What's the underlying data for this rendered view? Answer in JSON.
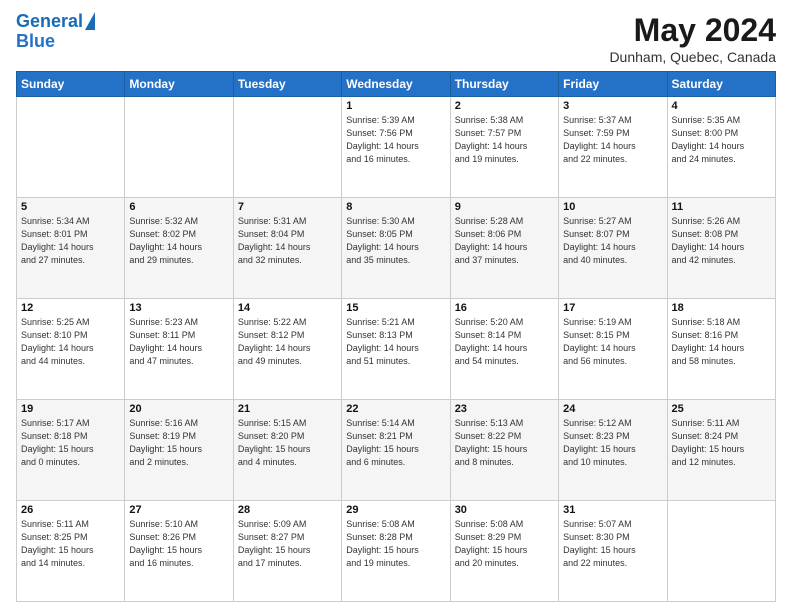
{
  "header": {
    "logo_line1": "General",
    "logo_line2": "Blue",
    "title": "May 2024",
    "location": "Dunham, Quebec, Canada"
  },
  "weekdays": [
    "Sunday",
    "Monday",
    "Tuesday",
    "Wednesday",
    "Thursday",
    "Friday",
    "Saturday"
  ],
  "weeks": [
    [
      {
        "day": "",
        "info": ""
      },
      {
        "day": "",
        "info": ""
      },
      {
        "day": "",
        "info": ""
      },
      {
        "day": "1",
        "info": "Sunrise: 5:39 AM\nSunset: 7:56 PM\nDaylight: 14 hours\nand 16 minutes."
      },
      {
        "day": "2",
        "info": "Sunrise: 5:38 AM\nSunset: 7:57 PM\nDaylight: 14 hours\nand 19 minutes."
      },
      {
        "day": "3",
        "info": "Sunrise: 5:37 AM\nSunset: 7:59 PM\nDaylight: 14 hours\nand 22 minutes."
      },
      {
        "day": "4",
        "info": "Sunrise: 5:35 AM\nSunset: 8:00 PM\nDaylight: 14 hours\nand 24 minutes."
      }
    ],
    [
      {
        "day": "5",
        "info": "Sunrise: 5:34 AM\nSunset: 8:01 PM\nDaylight: 14 hours\nand 27 minutes."
      },
      {
        "day": "6",
        "info": "Sunrise: 5:32 AM\nSunset: 8:02 PM\nDaylight: 14 hours\nand 29 minutes."
      },
      {
        "day": "7",
        "info": "Sunrise: 5:31 AM\nSunset: 8:04 PM\nDaylight: 14 hours\nand 32 minutes."
      },
      {
        "day": "8",
        "info": "Sunrise: 5:30 AM\nSunset: 8:05 PM\nDaylight: 14 hours\nand 35 minutes."
      },
      {
        "day": "9",
        "info": "Sunrise: 5:28 AM\nSunset: 8:06 PM\nDaylight: 14 hours\nand 37 minutes."
      },
      {
        "day": "10",
        "info": "Sunrise: 5:27 AM\nSunset: 8:07 PM\nDaylight: 14 hours\nand 40 minutes."
      },
      {
        "day": "11",
        "info": "Sunrise: 5:26 AM\nSunset: 8:08 PM\nDaylight: 14 hours\nand 42 minutes."
      }
    ],
    [
      {
        "day": "12",
        "info": "Sunrise: 5:25 AM\nSunset: 8:10 PM\nDaylight: 14 hours\nand 44 minutes."
      },
      {
        "day": "13",
        "info": "Sunrise: 5:23 AM\nSunset: 8:11 PM\nDaylight: 14 hours\nand 47 minutes."
      },
      {
        "day": "14",
        "info": "Sunrise: 5:22 AM\nSunset: 8:12 PM\nDaylight: 14 hours\nand 49 minutes."
      },
      {
        "day": "15",
        "info": "Sunrise: 5:21 AM\nSunset: 8:13 PM\nDaylight: 14 hours\nand 51 minutes."
      },
      {
        "day": "16",
        "info": "Sunrise: 5:20 AM\nSunset: 8:14 PM\nDaylight: 14 hours\nand 54 minutes."
      },
      {
        "day": "17",
        "info": "Sunrise: 5:19 AM\nSunset: 8:15 PM\nDaylight: 14 hours\nand 56 minutes."
      },
      {
        "day": "18",
        "info": "Sunrise: 5:18 AM\nSunset: 8:16 PM\nDaylight: 14 hours\nand 58 minutes."
      }
    ],
    [
      {
        "day": "19",
        "info": "Sunrise: 5:17 AM\nSunset: 8:18 PM\nDaylight: 15 hours\nand 0 minutes."
      },
      {
        "day": "20",
        "info": "Sunrise: 5:16 AM\nSunset: 8:19 PM\nDaylight: 15 hours\nand 2 minutes."
      },
      {
        "day": "21",
        "info": "Sunrise: 5:15 AM\nSunset: 8:20 PM\nDaylight: 15 hours\nand 4 minutes."
      },
      {
        "day": "22",
        "info": "Sunrise: 5:14 AM\nSunset: 8:21 PM\nDaylight: 15 hours\nand 6 minutes."
      },
      {
        "day": "23",
        "info": "Sunrise: 5:13 AM\nSunset: 8:22 PM\nDaylight: 15 hours\nand 8 minutes."
      },
      {
        "day": "24",
        "info": "Sunrise: 5:12 AM\nSunset: 8:23 PM\nDaylight: 15 hours\nand 10 minutes."
      },
      {
        "day": "25",
        "info": "Sunrise: 5:11 AM\nSunset: 8:24 PM\nDaylight: 15 hours\nand 12 minutes."
      }
    ],
    [
      {
        "day": "26",
        "info": "Sunrise: 5:11 AM\nSunset: 8:25 PM\nDaylight: 15 hours\nand 14 minutes."
      },
      {
        "day": "27",
        "info": "Sunrise: 5:10 AM\nSunset: 8:26 PM\nDaylight: 15 hours\nand 16 minutes."
      },
      {
        "day": "28",
        "info": "Sunrise: 5:09 AM\nSunset: 8:27 PM\nDaylight: 15 hours\nand 17 minutes."
      },
      {
        "day": "29",
        "info": "Sunrise: 5:08 AM\nSunset: 8:28 PM\nDaylight: 15 hours\nand 19 minutes."
      },
      {
        "day": "30",
        "info": "Sunrise: 5:08 AM\nSunset: 8:29 PM\nDaylight: 15 hours\nand 20 minutes."
      },
      {
        "day": "31",
        "info": "Sunrise: 5:07 AM\nSunset: 8:30 PM\nDaylight: 15 hours\nand 22 minutes."
      },
      {
        "day": "",
        "info": ""
      }
    ]
  ]
}
